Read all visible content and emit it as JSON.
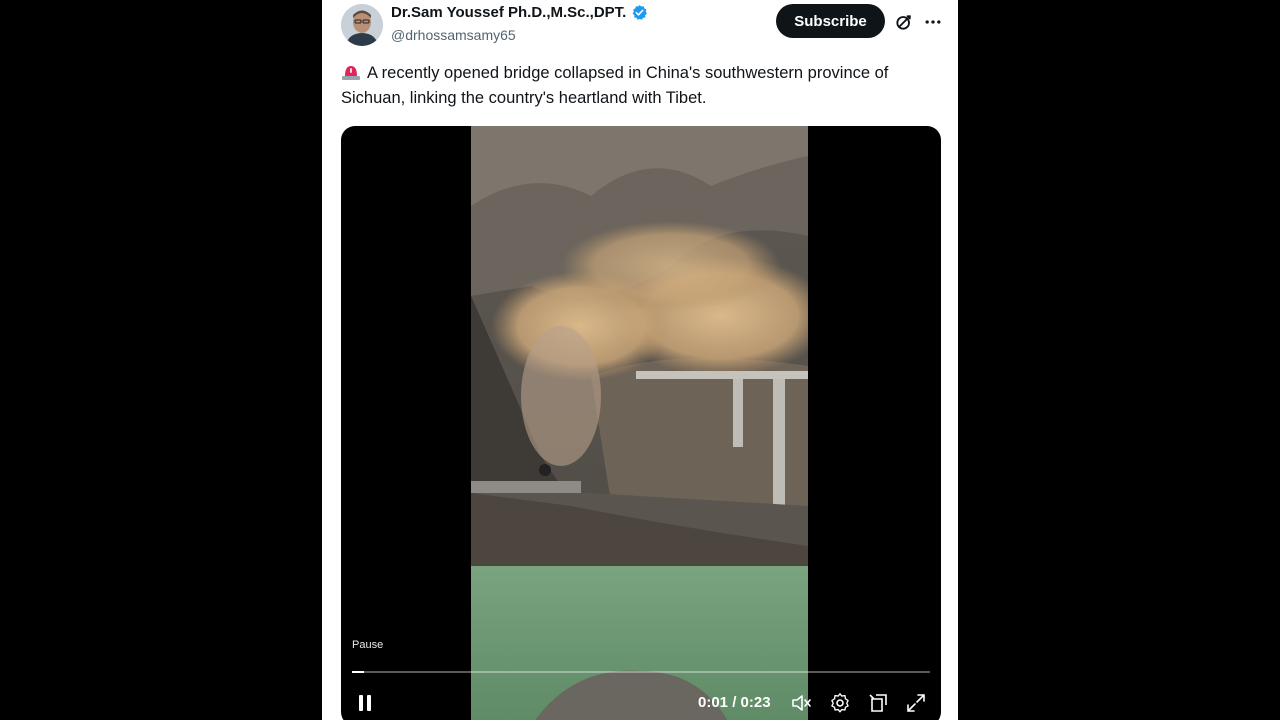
{
  "author": {
    "name": "Dr.Sam Youssef Ph.D.,M.Sc.,DPT.",
    "handle": "@drhossamsamy65",
    "verified": true,
    "verified_color": "#1d9bf0"
  },
  "actions": {
    "subscribe_label": "Subscribe",
    "grok_icon": "grok-icon",
    "more_icon": "more-icon"
  },
  "tweet": {
    "emoji": "siren-emoji",
    "text": "A recently opened bridge collapsed in China's southwestern province of Sichuan, linking the country's heartland with Tibet."
  },
  "video": {
    "pause_tooltip": "Pause",
    "time_display": "0:01 / 0:23",
    "progress_fraction": 0.02,
    "controls": [
      "pause-icon",
      "volume-icon",
      "settings-icon",
      "pip-icon",
      "fullscreen-icon"
    ]
  },
  "colors": {
    "text_primary": "#0f1419",
    "text_secondary": "#536471",
    "button_dark": "#0f1419"
  }
}
